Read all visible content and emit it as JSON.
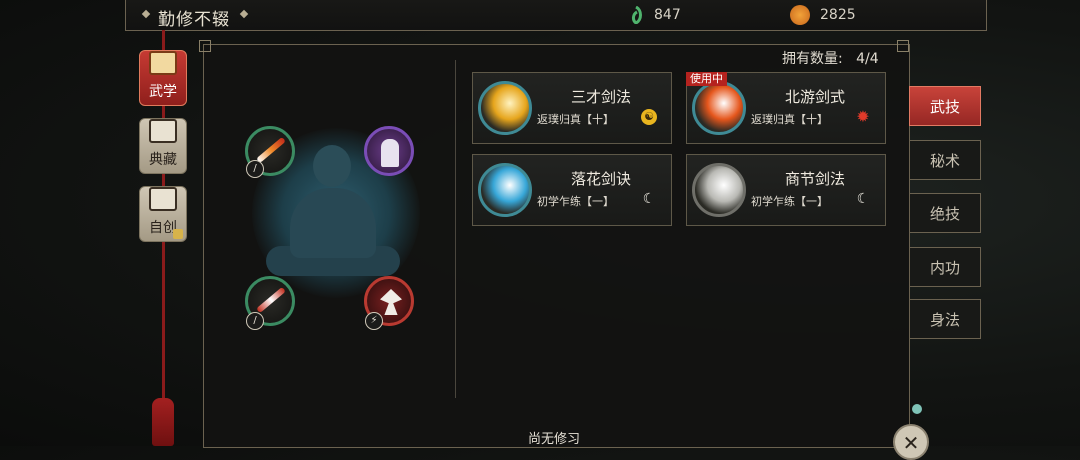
{
  "header": {
    "title": "勤修不辍"
  },
  "resources": [
    {
      "icon": "jade-icon",
      "value": "847"
    },
    {
      "icon": "coin-icon",
      "value": "2825"
    }
  ],
  "left_tabs": [
    {
      "label": "武学",
      "active": true
    },
    {
      "label": "典藏",
      "active": false
    },
    {
      "label": "自创",
      "active": false,
      "locked": true
    }
  ],
  "owned": {
    "label": "拥有数量:",
    "value": "4/4"
  },
  "skills": [
    {
      "name": "三才剑法",
      "level": "返璞归真【十】",
      "mark": "yinyang-icon",
      "in_use": false
    },
    {
      "name": "北游剑式",
      "level": "返璞归真【十】",
      "mark": "sun-icon",
      "in_use": true,
      "badge": "使用中"
    },
    {
      "name": "落花剑诀",
      "level": "初学乍练【一】",
      "mark": "moon-icon",
      "in_use": false
    },
    {
      "name": "商节剑法",
      "level": "初学乍练【一】",
      "mark": "moon-icon",
      "in_use": false
    }
  ],
  "right_tabs": [
    {
      "label": "武技",
      "active": true
    },
    {
      "label": "秘术"
    },
    {
      "label": "绝技"
    },
    {
      "label": "内功"
    },
    {
      "label": "身法"
    }
  ],
  "footer": {
    "status": "尚无修习"
  },
  "colors": {
    "accent_red": "#c63a33",
    "panel_border": "#6b6250",
    "sword_teal": "#3f8a95"
  }
}
